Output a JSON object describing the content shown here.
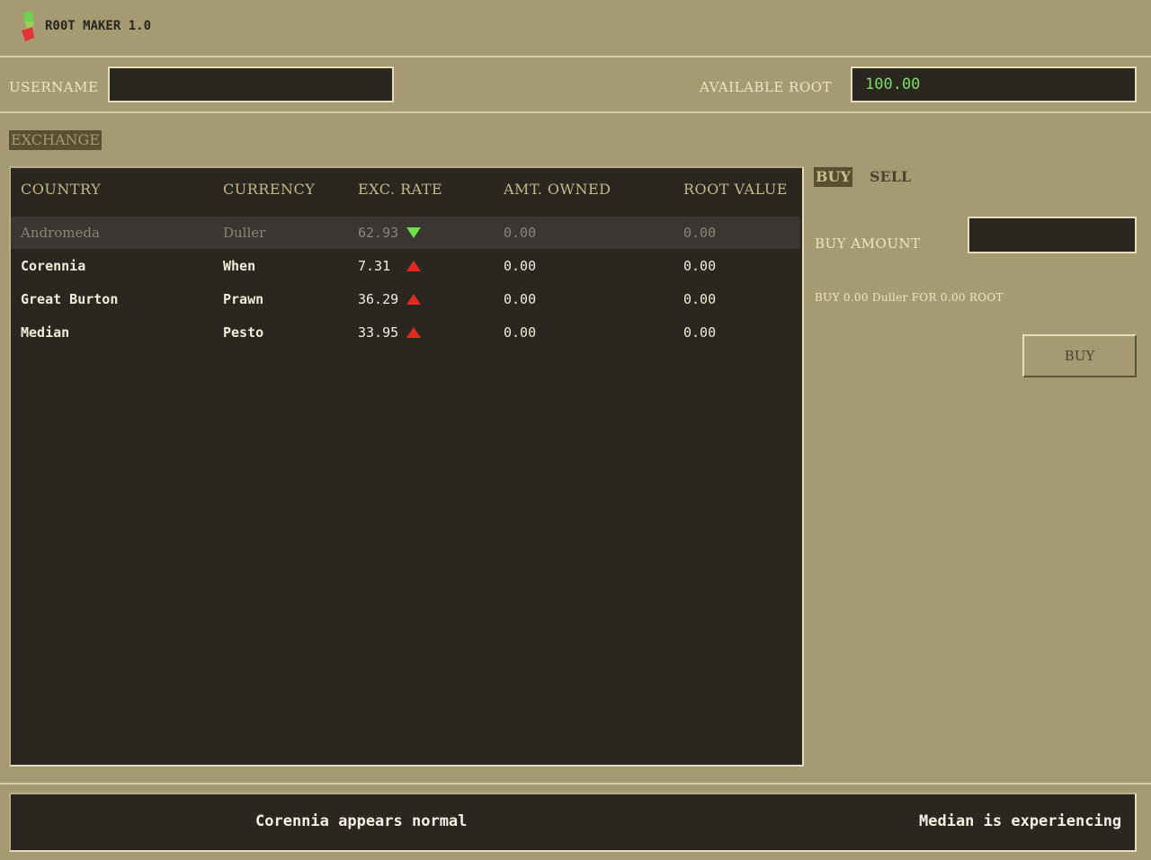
{
  "app": {
    "title": "R00T MAKER 1.0"
  },
  "user": {
    "username_label": "USERNAME",
    "username_value": "",
    "available_label": "AVAILABLE ROOT",
    "available_value": "100.00"
  },
  "exchange": {
    "section_label": "EXCHANGE",
    "columns": [
      "COUNTRY",
      "CURRENCY",
      "EXC. RATE",
      "AMT. OWNED",
      "ROOT VALUE"
    ],
    "rows": [
      {
        "country": "Andromeda",
        "currency": "Duller",
        "rate": "62.93",
        "trend": "down",
        "owned": "0.00",
        "value": "0.00"
      },
      {
        "country": "Corennia",
        "currency": "When",
        "rate": "7.31",
        "trend": "up",
        "owned": "0.00",
        "value": "0.00"
      },
      {
        "country": "Great Burton",
        "currency": "Prawn",
        "rate": "36.29",
        "trend": "up",
        "owned": "0.00",
        "value": "0.00"
      },
      {
        "country": "Median",
        "currency": "Pesto",
        "rate": "33.95",
        "trend": "up",
        "owned": "0.00",
        "value": "0.00"
      }
    ],
    "selected_row": 0
  },
  "trade": {
    "tabs": [
      "BUY",
      "SELL"
    ],
    "active_tab": "BUY",
    "amount_label": "BUY AMOUNT",
    "amount_value": "",
    "summary": "BUY 0.00 Duller FOR 0.00 ROOT",
    "button_label": "BUY"
  },
  "ticker": {
    "items": [
      "Corennia appears normal",
      "Median is experiencing"
    ]
  },
  "colors": {
    "background": "#a59a72",
    "panel": "#2a2620",
    "accent_green": "#7dde6a",
    "trend_up": "#e02a20",
    "trend_down": "#6ee04a"
  }
}
